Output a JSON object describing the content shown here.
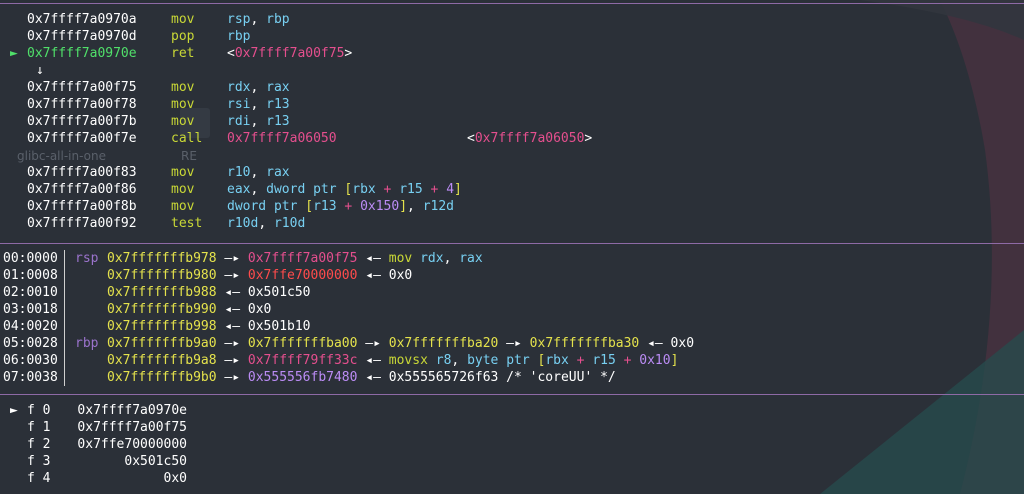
{
  "colors": {
    "background": "#2b3038",
    "rule": "#8e6aa6",
    "address": "#ffffff",
    "mnemonic": "#c9d836",
    "register": "#78d0f2",
    "code_pointer": "#e54f8e",
    "stack_pointer": "#e4e24c",
    "heap_pointer": "#bb8cf5",
    "data_pointer": "#ff4b4b",
    "current_marker": "#50e06a"
  },
  "watermark": {
    "left": "glibc-all-in-one",
    "right": "RE"
  },
  "disasm": [
    {
      "marker": "",
      "addr": "0x7ffff7a0970a",
      "mnem": "mov",
      "ops": [
        {
          "t": "rsp",
          "c": "reg"
        },
        {
          "t": ", ",
          "c": "white"
        },
        {
          "t": "rbp",
          "c": "reg"
        }
      ]
    },
    {
      "marker": "",
      "addr": "0x7ffff7a0970d",
      "mnem": "pop",
      "ops": [
        {
          "t": "rbp",
          "c": "reg"
        }
      ]
    },
    {
      "marker": "►",
      "addr": "0x7ffff7a0970e",
      "mnem": "ret",
      "ops": [
        {
          "t": "<",
          "c": "white"
        },
        {
          "t": "0x7ffff7a00f75",
          "c": "magenta"
        },
        {
          "t": ">",
          "c": "white"
        }
      ],
      "current": true
    },
    {
      "marker": "↓",
      "addr": "",
      "mnem": "",
      "ops": [],
      "arrow": true
    },
    {
      "marker": "",
      "addr": "0x7ffff7a00f75",
      "mnem": "mov",
      "ops": [
        {
          "t": "rdx",
          "c": "reg"
        },
        {
          "t": ", ",
          "c": "white"
        },
        {
          "t": "rax",
          "c": "reg"
        }
      ]
    },
    {
      "marker": "",
      "addr": "0x7ffff7a00f78",
      "mnem": "mov",
      "ops": [
        {
          "t": "rsi",
          "c": "reg"
        },
        {
          "t": ", ",
          "c": "white"
        },
        {
          "t": "r13",
          "c": "reg"
        }
      ]
    },
    {
      "marker": "",
      "addr": "0x7ffff7a00f7b",
      "mnem": "mov",
      "ops": [
        {
          "t": "rdi",
          "c": "reg"
        },
        {
          "t": ", ",
          "c": "white"
        },
        {
          "t": "r13",
          "c": "reg"
        }
      ]
    },
    {
      "marker": "",
      "addr": "0x7ffff7a00f7e",
      "mnem": "call",
      "ops": [
        {
          "t": "0x7ffff7a06050",
          "c": "magenta"
        }
      ],
      "target": "<0x7ffff7a06050>"
    },
    {
      "marker": "",
      "addr": "",
      "mnem": "",
      "ops": [],
      "blank": true
    },
    {
      "marker": "",
      "addr": "0x7ffff7a00f83",
      "mnem": "mov",
      "ops": [
        {
          "t": "r10",
          "c": "reg"
        },
        {
          "t": ", ",
          "c": "white"
        },
        {
          "t": "rax",
          "c": "reg"
        }
      ]
    },
    {
      "marker": "",
      "addr": "0x7ffff7a00f86",
      "mnem": "mov",
      "ops": [
        {
          "t": "eax",
          "c": "reg"
        },
        {
          "t": ", ",
          "c": "white"
        },
        {
          "t": "dword ptr ",
          "c": "reg"
        },
        {
          "t": "[",
          "c": "yellow"
        },
        {
          "t": "rbx",
          "c": "reg"
        },
        {
          "t": " + ",
          "c": "magenta"
        },
        {
          "t": "r15",
          "c": "reg"
        },
        {
          "t": " + ",
          "c": "magenta"
        },
        {
          "t": "4",
          "c": "purple"
        },
        {
          "t": "]",
          "c": "yellow"
        }
      ]
    },
    {
      "marker": "",
      "addr": "0x7ffff7a00f8b",
      "mnem": "mov",
      "ops": [
        {
          "t": "dword ptr ",
          "c": "reg"
        },
        {
          "t": "[",
          "c": "yellow"
        },
        {
          "t": "r13",
          "c": "reg"
        },
        {
          "t": " + ",
          "c": "magenta"
        },
        {
          "t": "0x150",
          "c": "purple"
        },
        {
          "t": "]",
          "c": "yellow"
        },
        {
          "t": ", ",
          "c": "white"
        },
        {
          "t": "r12d",
          "c": "reg"
        }
      ]
    },
    {
      "marker": "",
      "addr": "0x7ffff7a00f92",
      "mnem": "test",
      "ops": [
        {
          "t": "r10d",
          "c": "reg"
        },
        {
          "t": ", ",
          "c": "white"
        },
        {
          "t": "r10d",
          "c": "reg"
        }
      ]
    }
  ],
  "stack": [
    {
      "idx": "00:0000",
      "reg": "rsp",
      "chain": [
        {
          "t": "0x7fffffffb978",
          "c": "yellow"
        },
        {
          "t": " —▸ ",
          "c": "white"
        },
        {
          "t": "0x7ffff7a00f75",
          "c": "magenta"
        },
        {
          "t": " ◂— ",
          "c": "white"
        },
        {
          "t": "mov",
          "c": "mnem"
        },
        {
          "t": " ",
          "c": "white"
        },
        {
          "t": "rdx",
          "c": "reg"
        },
        {
          "t": ", ",
          "c": "white"
        },
        {
          "t": "rax",
          "c": "reg"
        }
      ]
    },
    {
      "idx": "01:0008",
      "reg": "",
      "chain": [
        {
          "t": "0x7fffffffb980",
          "c": "yellow"
        },
        {
          "t": " —▸ ",
          "c": "white"
        },
        {
          "t": "0x7ffe70000000",
          "c": "red"
        },
        {
          "t": " ◂— 0x0",
          "c": "white"
        }
      ]
    },
    {
      "idx": "02:0010",
      "reg": "",
      "chain": [
        {
          "t": "0x7fffffffb988",
          "c": "yellow"
        },
        {
          "t": " ◂— 0x501c50",
          "c": "white"
        }
      ]
    },
    {
      "idx": "03:0018",
      "reg": "",
      "chain": [
        {
          "t": "0x7fffffffb990",
          "c": "yellow"
        },
        {
          "t": " ◂— 0x0",
          "c": "white"
        }
      ]
    },
    {
      "idx": "04:0020",
      "reg": "",
      "chain": [
        {
          "t": "0x7fffffffb998",
          "c": "yellow"
        },
        {
          "t": " ◂— 0x501b10",
          "c": "white"
        }
      ]
    },
    {
      "idx": "05:0028",
      "reg": "rbp",
      "chain": [
        {
          "t": "0x7fffffffb9a0",
          "c": "yellow"
        },
        {
          "t": " —▸ ",
          "c": "white"
        },
        {
          "t": "0x7fffffffba00",
          "c": "yellow"
        },
        {
          "t": " —▸ ",
          "c": "white"
        },
        {
          "t": "0x7fffffffba20",
          "c": "yellow"
        },
        {
          "t": " —▸ ",
          "c": "white"
        },
        {
          "t": "0x7fffffffba30",
          "c": "yellow"
        },
        {
          "t": " ◂— 0x0",
          "c": "white"
        }
      ]
    },
    {
      "idx": "06:0030",
      "reg": "",
      "chain": [
        {
          "t": "0x7fffffffb9a8",
          "c": "yellow"
        },
        {
          "t": " —▸ ",
          "c": "white"
        },
        {
          "t": "0x7ffff79ff33c",
          "c": "magenta"
        },
        {
          "t": " ◂— ",
          "c": "white"
        },
        {
          "t": "movsx",
          "c": "mnem"
        },
        {
          "t": " ",
          "c": "white"
        },
        {
          "t": "r8",
          "c": "reg"
        },
        {
          "t": ", ",
          "c": "white"
        },
        {
          "t": "byte ptr ",
          "c": "reg"
        },
        {
          "t": "[",
          "c": "yellow"
        },
        {
          "t": "rbx",
          "c": "reg"
        },
        {
          "t": " + ",
          "c": "magenta"
        },
        {
          "t": "r15",
          "c": "reg"
        },
        {
          "t": " + ",
          "c": "magenta"
        },
        {
          "t": "0x10",
          "c": "purple"
        },
        {
          "t": "]",
          "c": "yellow"
        }
      ]
    },
    {
      "idx": "07:0038",
      "reg": "",
      "chain": [
        {
          "t": "0x7fffffffb9b0",
          "c": "yellow"
        },
        {
          "t": " —▸ ",
          "c": "white"
        },
        {
          "t": "0x555556fb7480",
          "c": "purple"
        },
        {
          "t": " ◂— 0x555565726f63 /* 'coreUU' */",
          "c": "white"
        }
      ]
    }
  ],
  "backtrace": [
    {
      "marker": "►",
      "frame": "f 0",
      "addr": "0x7ffff7a0970e"
    },
    {
      "marker": "",
      "frame": "f 1",
      "addr": "0x7ffff7a00f75"
    },
    {
      "marker": "",
      "frame": "f 2",
      "addr": "0x7ffe70000000"
    },
    {
      "marker": "",
      "frame": "f 3",
      "addr": "0x501c50"
    },
    {
      "marker": "",
      "frame": "f 4",
      "addr": "0x0"
    }
  ]
}
